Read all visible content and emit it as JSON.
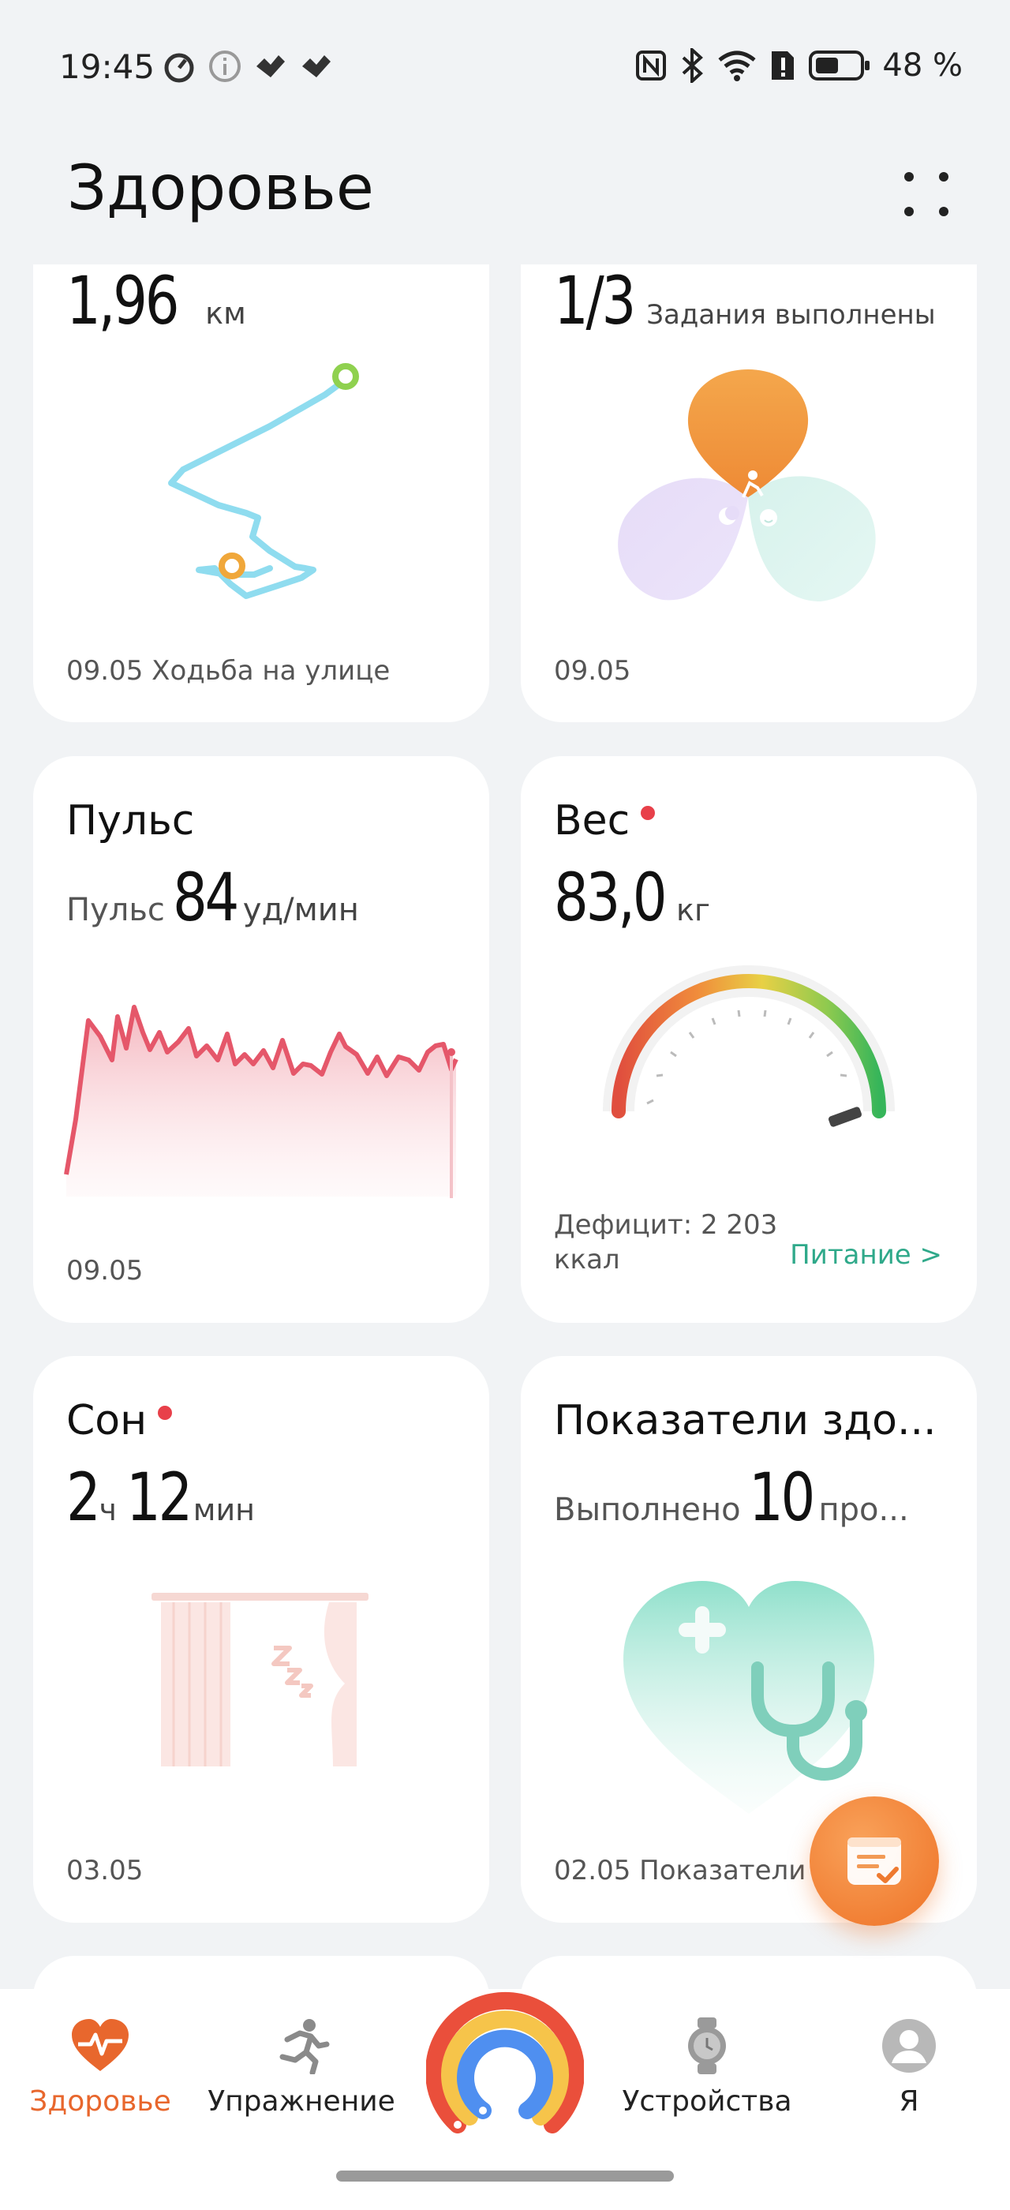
{
  "status": {
    "time": "19:45",
    "battery": "48 %"
  },
  "header": {
    "title": "Здоровье"
  },
  "cards": {
    "walk": {
      "distance": "1,96",
      "unit": "км",
      "date": "09.05",
      "activity": "Ходьба на улице"
    },
    "tasks": {
      "value": "1/3",
      "label": "Задания выполнены",
      "date": "09.05"
    },
    "pulse": {
      "title": "Пульс",
      "sub_label": "Пульс",
      "value": "84",
      "unit": "уд/мин",
      "date": "09.05"
    },
    "weight": {
      "title": "Вес",
      "value": "83,0",
      "unit": "кг",
      "deficit_line1": "Дефицит: 2 203",
      "deficit_line2": "ккал",
      "link": "Питание >"
    },
    "sleep": {
      "title": "Сон",
      "hours": "2",
      "hours_unit": "ч",
      "minutes": "12",
      "minutes_unit": "мин",
      "date": "03.05"
    },
    "health": {
      "title": "Показатели здо...",
      "sub_label": "Выполнено",
      "value": "10",
      "sub_tail": "про...",
      "footer": "02.05 Показатели з"
    }
  },
  "tabs": [
    {
      "label": "Здоровье",
      "active": true,
      "color": "#e8672d"
    },
    {
      "label": "Упражнение",
      "active": false
    },
    {
      "label": "Устройства",
      "active": false
    },
    {
      "label": "Я",
      "active": false
    }
  ],
  "colors": {
    "accent": "#e8672d",
    "pulse_line": "#e5576a",
    "link_green": "#2fa98a",
    "alert_red": "#e8404a"
  }
}
